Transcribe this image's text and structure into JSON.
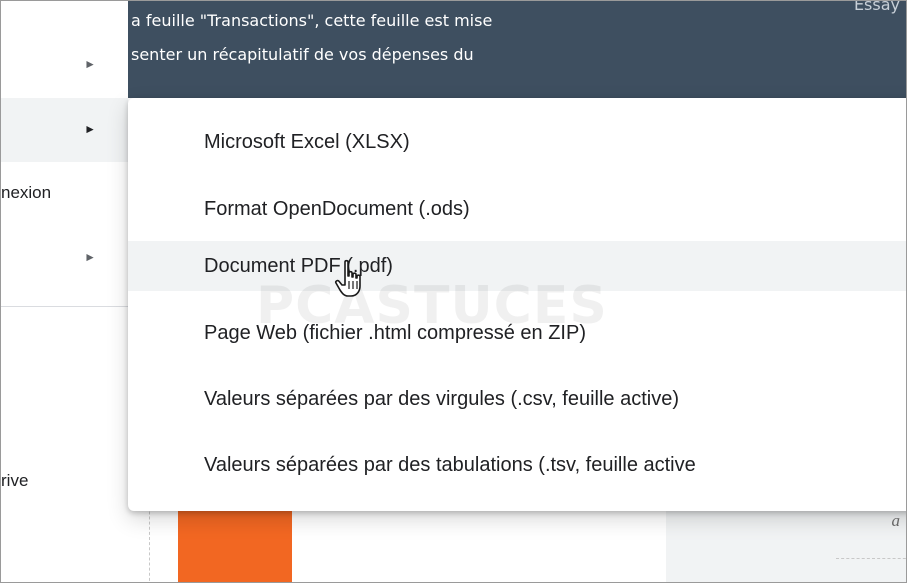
{
  "banner": {
    "line1": "a feuille \"Transactions\", cette feuille est mise",
    "line2": "senter un récapitulatif de vos dépenses du",
    "corner_text": "Essay"
  },
  "left_menu": {
    "items": [
      {
        "label": "",
        "arrow": "►"
      },
      {
        "label": "",
        "arrow": "►"
      },
      {
        "label": "nexion",
        "arrow": ""
      },
      {
        "label": "",
        "arrow": "►"
      },
      {
        "label": "rive",
        "arrow": ""
      }
    ]
  },
  "submenu": {
    "items": [
      {
        "label": "Microsoft Excel (XLSX)"
      },
      {
        "label": "Format OpenDocument (.ods)"
      },
      {
        "label": "Document PDF (.pdf)"
      },
      {
        "label": "Page Web (fichier .html compressé en ZIP)"
      },
      {
        "label": "Valeurs séparées par des virgules (.csv, feuille active)"
      },
      {
        "label": "Valeurs séparées par des tabulations (.tsv, feuille active"
      }
    ],
    "hovered_index": 2
  },
  "background": {
    "side_text": "a",
    "watermark": "PCASTUCES"
  },
  "colors": {
    "banner": "#3e4f60",
    "accent_orange": "#f26722",
    "hover": "#f1f3f4"
  },
  "icons": {
    "cursor": "hand-pointer-icon",
    "submenu_arrow": "triangle-right-icon"
  }
}
